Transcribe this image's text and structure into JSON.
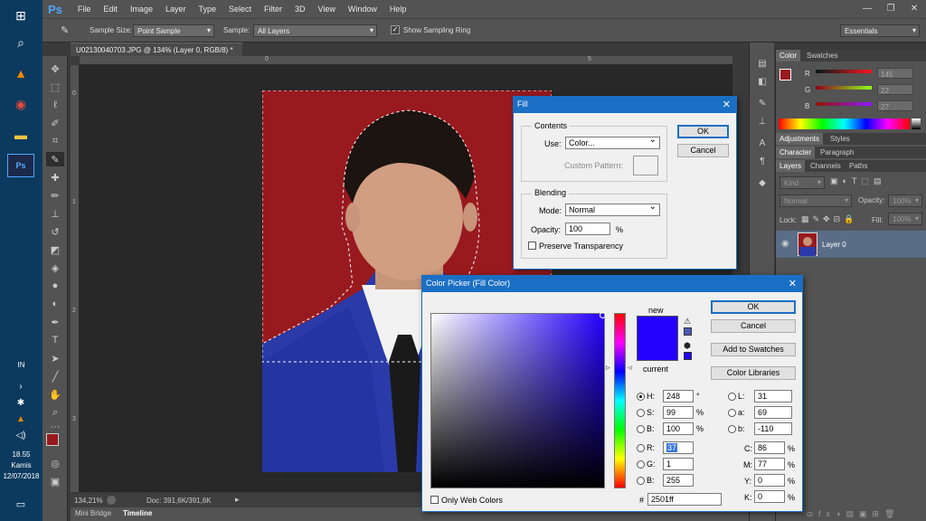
{
  "taskbar": {
    "lang": "IN",
    "time": "18.55",
    "day": "Kamis",
    "date": "12/07/2018"
  },
  "menubar": {
    "logo": "Ps",
    "items": [
      "File",
      "Edit",
      "Image",
      "Layer",
      "Type",
      "Select",
      "Filter",
      "3D",
      "View",
      "Window",
      "Help"
    ]
  },
  "options": {
    "sample_size_label": "Sample Size:",
    "sample_size_value": "Point Sample",
    "sample_label": "Sample:",
    "sample_value": "All Layers",
    "show_ring_label": "Show Sampling Ring",
    "workspace": "Essentials"
  },
  "document": {
    "tab": "U02130040703.JPG @ 134% (Layer 0, RGB/8) *",
    "zoom": "134,21%",
    "doc_info": "Doc: 391,6K/391,6K"
  },
  "ruler": {
    "h_ticks": [
      "0",
      "5"
    ],
    "v_ticks": [
      "0",
      "1",
      "2",
      "3"
    ]
  },
  "bottom_tabs": [
    "Mini Bridge",
    "Timeline"
  ],
  "panels": {
    "color_tabs": [
      "Color",
      "Swatches"
    ],
    "sliders": [
      {
        "label": "R",
        "value": "145"
      },
      {
        "label": "G",
        "value": "22"
      },
      {
        "label": "B",
        "value": "27"
      }
    ],
    "adj_tabs": [
      "Adjustments",
      "Styles"
    ],
    "char_tabs": [
      "Character",
      "Paragraph"
    ],
    "layer_tabs": [
      "Layers",
      "Channels",
      "Paths"
    ],
    "kind": "Kind",
    "blend": "Normal",
    "opacity_label": "Opacity:",
    "opacity": "100%",
    "lock_label": "Lock:",
    "fill_label": "Fill:",
    "fill": "100%",
    "layer_name": "Layer 0"
  },
  "fill_dialog": {
    "title": "Fill",
    "close": "✕",
    "contents_label": "Contents",
    "use_label": "Use:",
    "use_value": "Color...",
    "custom_pattern_label": "Custom Pattern:",
    "blending_label": "Blending",
    "mode_label": "Mode:",
    "mode_value": "Normal",
    "opacity_label": "Opacity:",
    "opacity_value": "100",
    "opacity_unit": "%",
    "preserve_label": "Preserve Transparency",
    "ok": "OK",
    "cancel": "Cancel"
  },
  "picker": {
    "title": "Color Picker (Fill Color)",
    "close": "✕",
    "new_label": "new",
    "current_label": "current",
    "new_color": "#2501ff",
    "current_color": "#2501ff",
    "ok": "OK",
    "cancel": "Cancel",
    "add_swatches": "Add to Swatches",
    "libraries": "Color Libraries",
    "hsb": [
      {
        "label": "H:",
        "value": "248",
        "unit": "°"
      },
      {
        "label": "S:",
        "value": "99",
        "unit": "%"
      },
      {
        "label": "B:",
        "value": "100",
        "unit": "%"
      }
    ],
    "rgb": [
      {
        "label": "R:",
        "value": "37"
      },
      {
        "label": "G:",
        "value": "1"
      },
      {
        "label": "B:",
        "value": "255"
      }
    ],
    "lab": [
      {
        "label": "L:",
        "value": "31"
      },
      {
        "label": "a:",
        "value": "69"
      },
      {
        "label": "b:",
        "value": "-110"
      }
    ],
    "cmyk": [
      {
        "label": "C:",
        "value": "86",
        "unit": "%"
      },
      {
        "label": "M:",
        "value": "77",
        "unit": "%"
      },
      {
        "label": "Y:",
        "value": "0",
        "unit": "%"
      },
      {
        "label": "K:",
        "value": "0",
        "unit": "%"
      }
    ],
    "hex_label": "#",
    "hex": "2501ff",
    "web_only_label": "Only Web Colors"
  }
}
